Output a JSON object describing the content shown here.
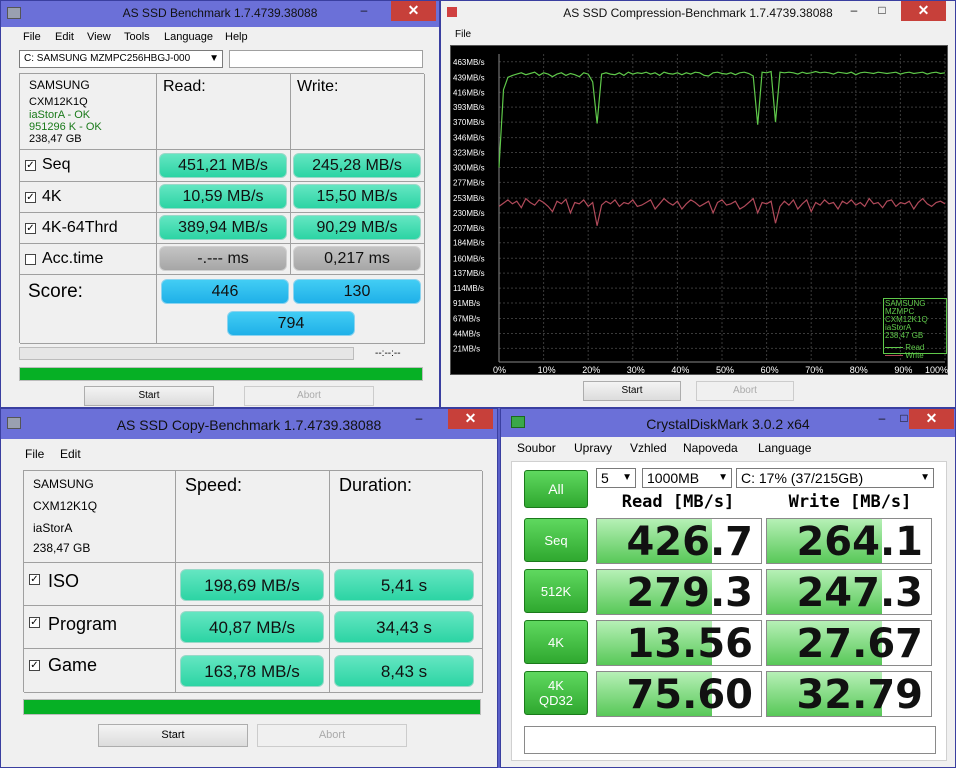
{
  "win1": {
    "title": "AS SSD Benchmark 1.7.4739.38088",
    "minimize": "–",
    "close": "✕",
    "menu": [
      "File",
      "Edit",
      "View",
      "Tools",
      "Language",
      "Help"
    ],
    "drive_select": "C: SAMSUNG MZMPC256HBGJ-000",
    "drive_info": {
      "model": "SAMSUNG",
      "firmware": "CXM12K1Q",
      "driver": "iaStorA - OK",
      "alignment": "951296 K - OK",
      "size": "238,47 GB"
    },
    "read_header": "Read:",
    "write_header": "Write:",
    "rows": [
      {
        "label": "Seq",
        "checked": true,
        "read": "451,21 MB/s",
        "write": "245,28 MB/s"
      },
      {
        "label": "4K",
        "checked": true,
        "read": "10,59 MB/s",
        "write": "15,50 MB/s"
      },
      {
        "label": "4K-64Thrd",
        "checked": true,
        "read": "389,94 MB/s",
        "write": "90,29 MB/s"
      },
      {
        "label": "Acc.time",
        "checked": false,
        "read": "-.--- ms",
        "write": "0,217 ms"
      }
    ],
    "score_label": "Score:",
    "score_read": "446",
    "score_write": "130",
    "score_total": "794",
    "elapsed": "--:--:--",
    "progress": 100,
    "start": "Start",
    "abort": "Abort"
  },
  "win2": {
    "title": "AS SSD Compression-Benchmark 1.7.4739.38088",
    "minimize": "–",
    "maximize": "□",
    "close": "✕",
    "menu": [
      "File"
    ],
    "legend_drive": "SAMSUNG MZMPC",
    "legend_fw": "CXM12K1Q",
    "legend_driver": "iaStorA",
    "legend_size": "238,47 GB",
    "start": "Start",
    "abort": "Abort"
  },
  "chart_data": {
    "type": "line",
    "y_ticks": [
      "463MB/s",
      "439MB/s",
      "416MB/s",
      "393MB/s",
      "370MB/s",
      "346MB/s",
      "323MB/s",
      "300MB/s",
      "277MB/s",
      "253MB/s",
      "230MB/s",
      "207MB/s",
      "184MB/s",
      "160MB/s",
      "137MB/s",
      "114MB/s",
      "91MB/s",
      "67MB/s",
      "44MB/s",
      "21MB/s"
    ],
    "x_ticks": [
      "0%",
      "10%",
      "20%",
      "30%",
      "40%",
      "50%",
      "60%",
      "70%",
      "80%",
      "90%",
      "100%"
    ],
    "ylim": [
      0,
      475
    ],
    "colors": {
      "read": "#5fc84a",
      "write": "#b04a5a"
    },
    "series": [
      {
        "name": "Read",
        "values": [
          300,
          420,
          439,
          442,
          444,
          446,
          443,
          445,
          447,
          442,
          446,
          444,
          440,
          444,
          446,
          442,
          445,
          443,
          440,
          446,
          444,
          432,
          368,
          444,
          446,
          444,
          443,
          446,
          442,
          447,
          444,
          446,
          445,
          447,
          444,
          446,
          442,
          447,
          445,
          444,
          446,
          443,
          446,
          444,
          447,
          446,
          442,
          441,
          446,
          447,
          445,
          444,
          446,
          443,
          446,
          447,
          445,
          441,
          366,
          447,
          446,
          448,
          370,
          447,
          446,
          447,
          446,
          444,
          447,
          445,
          446,
          448,
          446,
          447,
          446,
          444,
          447,
          446,
          445,
          447,
          443,
          446,
          447,
          446,
          445,
          447,
          446,
          445,
          446,
          447,
          444,
          446,
          447,
          445,
          446,
          447,
          444,
          446,
          447,
          445,
          446
        ]
      },
      {
        "name": "Write",
        "values": [
          240,
          245,
          250,
          244,
          248,
          238,
          252,
          246,
          242,
          250,
          246,
          240,
          232,
          248,
          244,
          251,
          230,
          246,
          244,
          250,
          240,
          246,
          210,
          242,
          248,
          244,
          250,
          240,
          246,
          244,
          250,
          240,
          242,
          246,
          250,
          236,
          244,
          252,
          246,
          242,
          248,
          236,
          244,
          250,
          246,
          240,
          244,
          248,
          230,
          246,
          250,
          242,
          244,
          248,
          236,
          240,
          246,
          252,
          230,
          246,
          244,
          248,
          214,
          240,
          248,
          242,
          250,
          236,
          244,
          250,
          232,
          246,
          242,
          250,
          244,
          246,
          236,
          248,
          244,
          250,
          242,
          246,
          240,
          252,
          244,
          246,
          238,
          248,
          250,
          240,
          246,
          244,
          248,
          236,
          246,
          252,
          244,
          240,
          246,
          248,
          244
        ]
      }
    ]
  },
  "win3": {
    "title": "AS SSD Copy-Benchmark 1.7.4739.38088",
    "minimize": "–",
    "close": "✕",
    "menu": [
      "File",
      "Edit"
    ],
    "drive_info": {
      "model": "SAMSUNG",
      "firmware": "CXM12K1Q",
      "driver": "iaStorA",
      "size": "238,47 GB"
    },
    "speed_header": "Speed:",
    "duration_header": "Duration:",
    "rows": [
      {
        "label": "ISO",
        "checked": true,
        "speed": "198,69 MB/s",
        "duration": "5,41 s"
      },
      {
        "label": "Program",
        "checked": true,
        "speed": "40,87 MB/s",
        "duration": "34,43 s"
      },
      {
        "label": "Game",
        "checked": true,
        "speed": "163,78 MB/s",
        "duration": "8,43 s"
      }
    ],
    "progress": 100,
    "start": "Start",
    "abort": "Abort"
  },
  "win4": {
    "title": "CrystalDiskMark 3.0.2 x64",
    "minimize": "–",
    "maximize": "□",
    "close": "✕",
    "menu": [
      "Soubor",
      "Upravy",
      "Vzhled",
      "Napoveda",
      "Language"
    ],
    "count": "5",
    "size": "1000MB",
    "drive": "C: 17% (37/215GB)",
    "all_button": "All",
    "read_header": "Read [MB/s]",
    "write_header": "Write [MB/s]",
    "rows": [
      {
        "label": "Seq",
        "read": "426.7",
        "write": "264.1",
        "read_fill": 0.7,
        "write_fill": 0.7
      },
      {
        "label": "512K",
        "read": "279.3",
        "write": "247.3",
        "read_fill": 0.7,
        "write_fill": 0.7
      },
      {
        "label": "4K",
        "read": "13.56",
        "write": "27.67",
        "read_fill": 0.7,
        "write_fill": 0.7
      },
      {
        "label": "4K\nQD32",
        "read": "75.60",
        "write": "32.79",
        "read_fill": 0.7,
        "write_fill": 0.7
      }
    ],
    "comment": ""
  }
}
